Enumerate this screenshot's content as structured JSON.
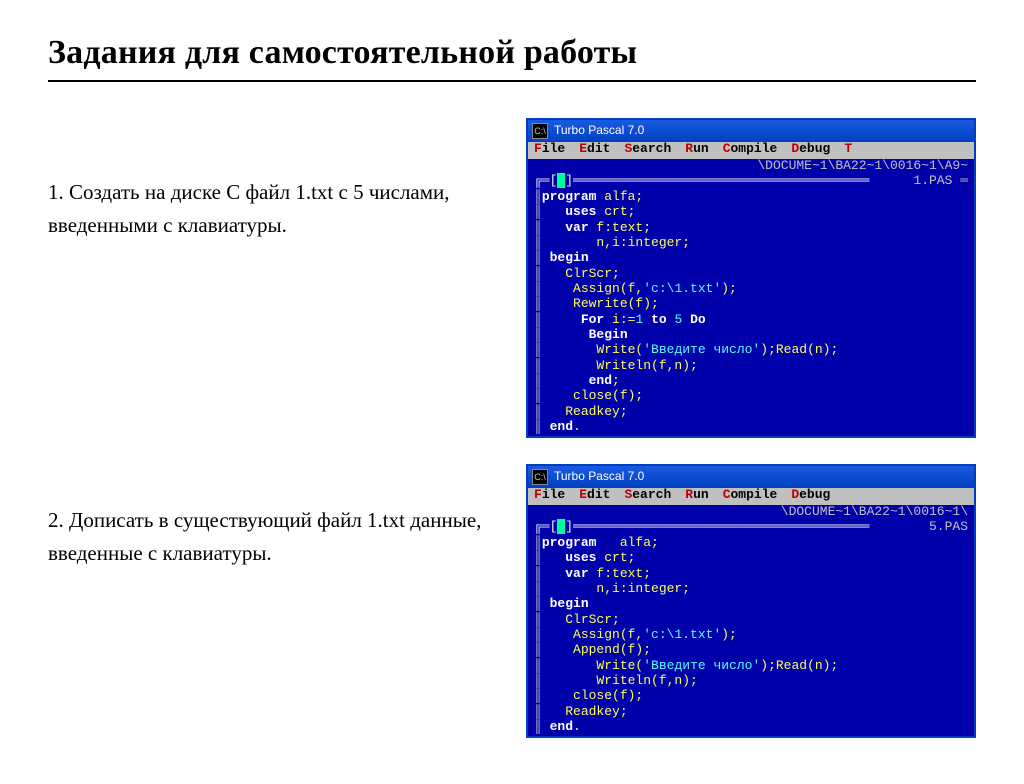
{
  "title": "Задания для самостоятельной работы",
  "task1": "1. Создать на  диске  С  файл  1.txt  с  5 числами,  введенными с клавиатуры.",
  "task2": "2. Дописать  в  существующий  файл  1.txt данные,  введенные с клавиатуры.",
  "window1": {
    "sysicon": "C:\\",
    "title": "Turbo Pascal 7.0",
    "menu": [
      {
        "hot": "F",
        "rest": "ile"
      },
      {
        "hot": "E",
        "rest": "dit"
      },
      {
        "hot": "S",
        "rest": "earch"
      },
      {
        "hot": "R",
        "rest": "un"
      },
      {
        "hot": "C",
        "rest": "ompile"
      },
      {
        "hot": "D",
        "rest": "ebug"
      },
      {
        "hot": "T",
        "rest": ""
      }
    ],
    "path": "\\DOCUME~1\\BA22~1\\0016~1\\A9~",
    "filename": "1.PAS ═",
    "code_lines": [
      [
        [
          "kw",
          "program"
        ],
        [
          "id",
          " alfa;"
        ]
      ],
      [
        [
          "id",
          "   "
        ],
        [
          "kw",
          "uses"
        ],
        [
          "id",
          " crt;"
        ]
      ],
      [
        [
          "id",
          "   "
        ],
        [
          "kw",
          "var"
        ],
        [
          "id",
          " f:text;"
        ]
      ],
      [
        [
          "id",
          "       n,i:integer;"
        ]
      ],
      [
        [
          "id",
          " "
        ],
        [
          "kw",
          "begin"
        ]
      ],
      [
        [
          "id",
          "   ClrScr;"
        ]
      ],
      [
        [
          "id",
          "    Assign(f,"
        ],
        [
          "str",
          "'c:\\1.txt'"
        ],
        [
          "id",
          ");"
        ]
      ],
      [
        [
          "id",
          "    Rewrite(f);"
        ]
      ],
      [
        [
          "id",
          "     "
        ],
        [
          "kw",
          "For"
        ],
        [
          "id",
          " i:="
        ],
        [
          "num",
          "1"
        ],
        [
          "id",
          " "
        ],
        [
          "kw",
          "to"
        ],
        [
          "id",
          " "
        ],
        [
          "num",
          "5"
        ],
        [
          "id",
          " "
        ],
        [
          "kw",
          "Do"
        ]
      ],
      [
        [
          "id",
          "      "
        ],
        [
          "kw",
          "Begin"
        ]
      ],
      [
        [
          "id",
          "       Write("
        ],
        [
          "str",
          "'Введите число'"
        ],
        [
          "id",
          ");Read(n);"
        ]
      ],
      [
        [
          "id",
          "       Writeln(f,n);"
        ]
      ],
      [
        [
          "id",
          "      "
        ],
        [
          "kw",
          "end"
        ],
        [
          "id",
          ";"
        ]
      ],
      [
        [
          "id",
          "    close(f);"
        ]
      ],
      [
        [
          "id",
          "   Readkey;"
        ]
      ],
      [
        [
          "id",
          " "
        ],
        [
          "kw",
          "end"
        ],
        [
          "id",
          "."
        ]
      ]
    ]
  },
  "window2": {
    "sysicon": "C:\\",
    "title": "Turbo Pascal 7.0",
    "menu": [
      {
        "hot": "F",
        "rest": "ile"
      },
      {
        "hot": "E",
        "rest": "dit"
      },
      {
        "hot": "S",
        "rest": "earch"
      },
      {
        "hot": "R",
        "rest": "un"
      },
      {
        "hot": "C",
        "rest": "ompile"
      },
      {
        "hot": "D",
        "rest": "ebug"
      }
    ],
    "path": "\\DOCUME~1\\BA22~1\\0016~1\\",
    "filename": "5.PAS",
    "code_lines": [
      [
        [
          "kw",
          "program"
        ],
        [
          "id",
          "   alfa;"
        ]
      ],
      [
        [
          "id",
          "   "
        ],
        [
          "kw",
          "uses"
        ],
        [
          "id",
          " crt;"
        ]
      ],
      [
        [
          "id",
          "   "
        ],
        [
          "kw",
          "var"
        ],
        [
          "id",
          " f:text;"
        ]
      ],
      [
        [
          "id",
          "       n,i:integer;"
        ]
      ],
      [
        [
          "id",
          " "
        ],
        [
          "kw",
          "begin"
        ]
      ],
      [
        [
          "id",
          "   ClrScr;"
        ]
      ],
      [
        [
          "id",
          "    Assign(f,"
        ],
        [
          "str",
          "'c:\\1.txt'"
        ],
        [
          "id",
          ");"
        ]
      ],
      [
        [
          "id",
          "    Append(f);"
        ]
      ],
      [
        [
          "id",
          "       Write("
        ],
        [
          "str",
          "'Введите число'"
        ],
        [
          "id",
          ");Read(n);"
        ]
      ],
      [
        [
          "id",
          "       Writeln(f,n);"
        ]
      ],
      [
        [
          "id",
          "    close(f);"
        ]
      ],
      [
        [
          "id",
          "   Readkey;"
        ]
      ],
      [
        [
          "id",
          " "
        ],
        [
          "kw",
          "end"
        ],
        [
          "id",
          "."
        ]
      ]
    ]
  }
}
